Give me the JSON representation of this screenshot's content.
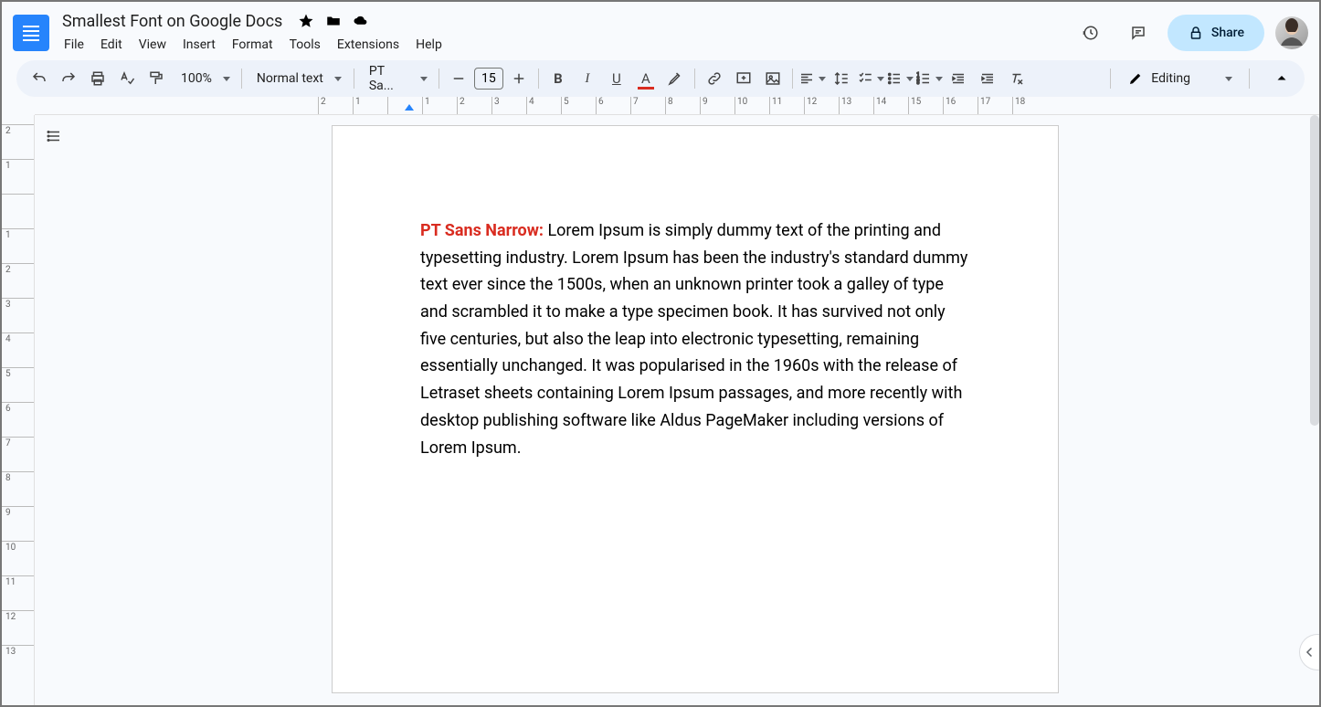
{
  "header": {
    "doc_title": "Smallest Font on Google Docs",
    "menus": [
      "File",
      "Edit",
      "View",
      "Insert",
      "Format",
      "Tools",
      "Extensions",
      "Help"
    ],
    "share_label": "Share"
  },
  "toolbar": {
    "zoom": "100%",
    "style": "Normal text",
    "font": "PT Sa...",
    "font_size": "15",
    "editing_mode": "Editing"
  },
  "ruler_h": [
    "2",
    "1",
    "",
    "1",
    "2",
    "3",
    "4",
    "5",
    "6",
    "7",
    "8",
    "9",
    "10",
    "11",
    "12",
    "13",
    "14",
    "15",
    "16",
    "17",
    "18"
  ],
  "ruler_v": [
    "2",
    "1",
    "",
    "1",
    "2",
    "3",
    "4",
    "5",
    "6",
    "7",
    "8",
    "9",
    "10",
    "11",
    "12",
    "13"
  ],
  "document": {
    "label": "PT Sans Narrow: ",
    "body": "Lorem Ipsum is simply dummy text of the printing and typesetting industry. Lorem Ipsum has been the industry's standard dummy text ever since the 1500s, when an unknown printer took a galley of type and scrambled it to make a type specimen book. It has survived not only five centuries, but also the leap into electronic typesetting, remaining essentially unchanged. It was popularised in the 1960s with the release of Letraset sheets containing Lorem Ipsum passages, and more recently with desktop publishing software like Aldus PageMaker including versions of Lorem Ipsum."
  }
}
